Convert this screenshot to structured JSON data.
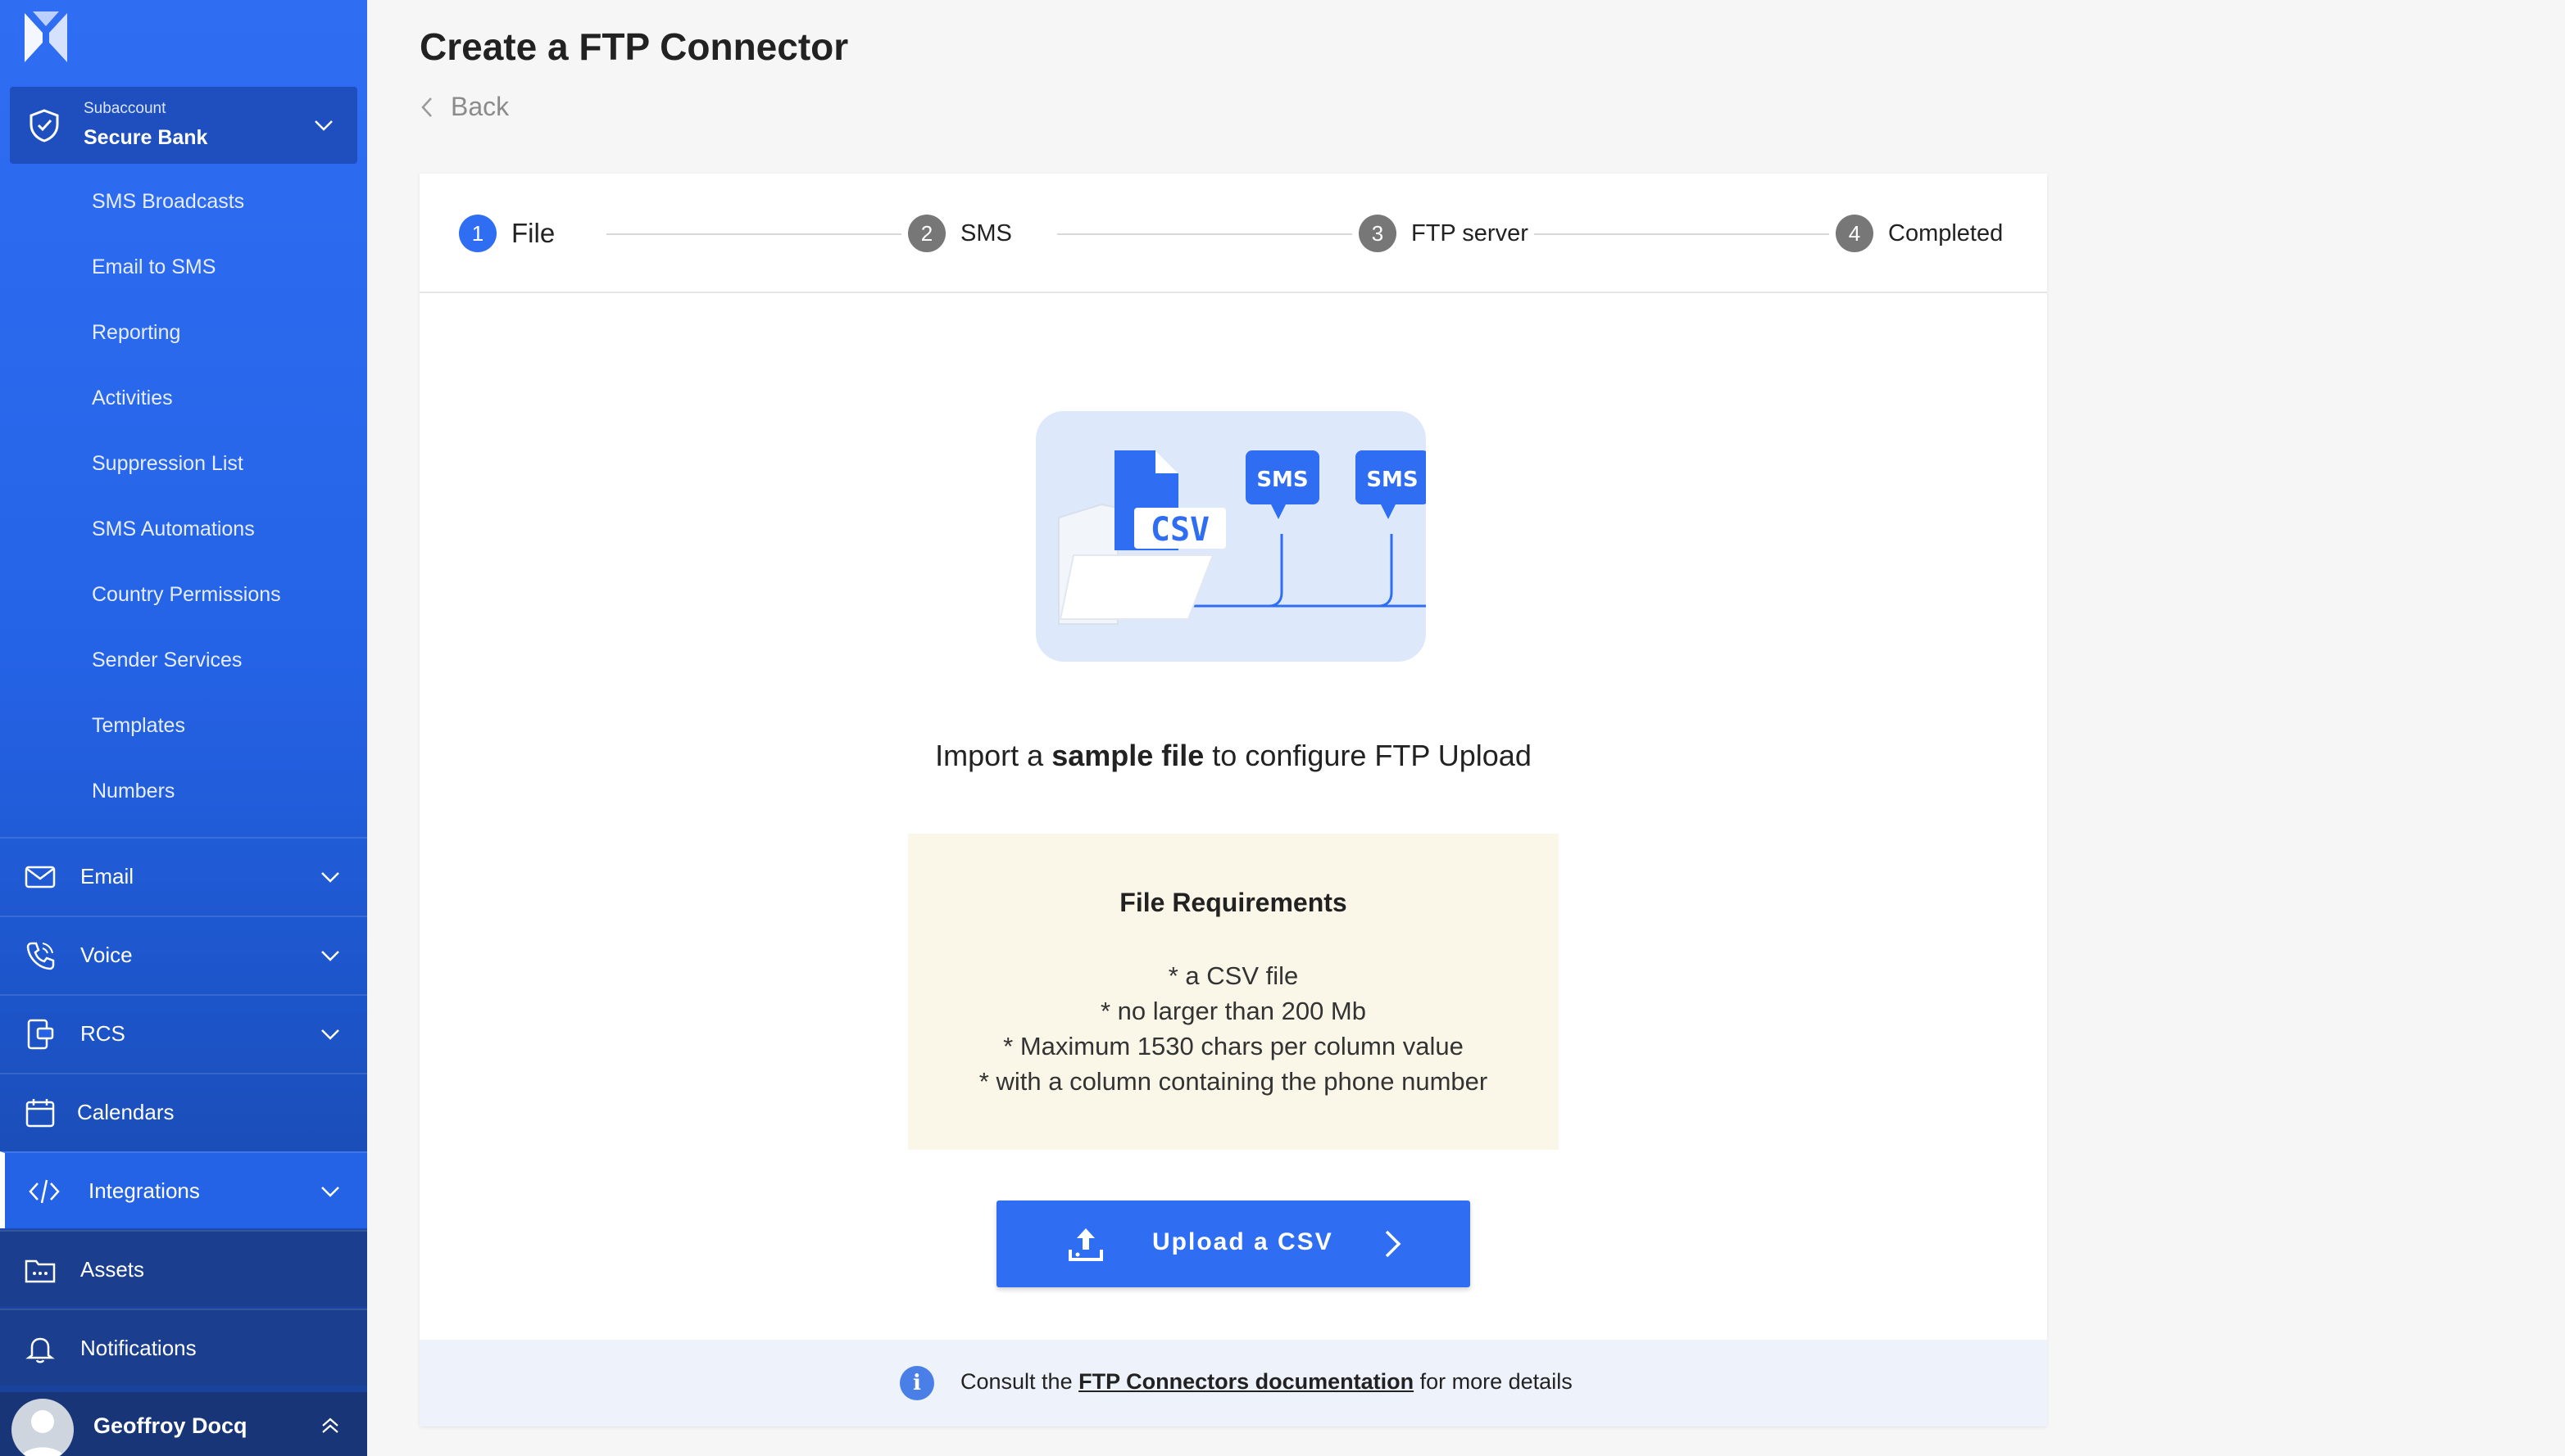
{
  "sidebar": {
    "subaccount": {
      "label": "Subaccount",
      "name": "Secure Bank"
    },
    "subitems": [
      "SMS Broadcasts",
      "Email to SMS",
      "Reporting",
      "Activities",
      "Suppression List",
      "SMS Automations",
      "Country Permissions",
      "Sender Services",
      "Templates",
      "Numbers"
    ],
    "nav": {
      "email": "Email",
      "voice": "Voice",
      "rcs": "RCS",
      "calendars": "Calendars",
      "integrations": "Integrations",
      "assets": "Assets",
      "notifications": "Notifications"
    },
    "user": {
      "name": "Geoffroy Docq"
    }
  },
  "page": {
    "title": "Create a FTP Connector",
    "back": "Back"
  },
  "stepper": [
    {
      "num": "1",
      "label": "File",
      "active": true
    },
    {
      "num": "2",
      "label": "SMS",
      "active": false
    },
    {
      "num": "3",
      "label": "FTP server",
      "active": false
    },
    {
      "num": "4",
      "label": "Completed",
      "active": false
    }
  ],
  "illustration": {
    "file_badge": "CSV",
    "bubble1": "SMS",
    "bubble2": "SMS"
  },
  "headline": {
    "part1": "Import a ",
    "bold": "sample file",
    "part2": " to configure FTP Upload"
  },
  "requirements": {
    "title": "File Requirements",
    "lines": [
      "* a CSV file",
      "* no larger than 200 Mb",
      "* Maximum 1530 chars per column value",
      "* with a column containing the phone number"
    ]
  },
  "upload_button": {
    "label": "Upload a CSV"
  },
  "footer": {
    "prefix": "Consult the ",
    "link": "FTP Connectors documentation",
    "suffix": " for more details",
    "info_glyph": "i"
  },
  "colors": {
    "primary": "#2f6df3",
    "sidebar_dark": "#173f94",
    "requirements_bg": "#fbf7e8",
    "footer_bg": "#edf2fb"
  }
}
